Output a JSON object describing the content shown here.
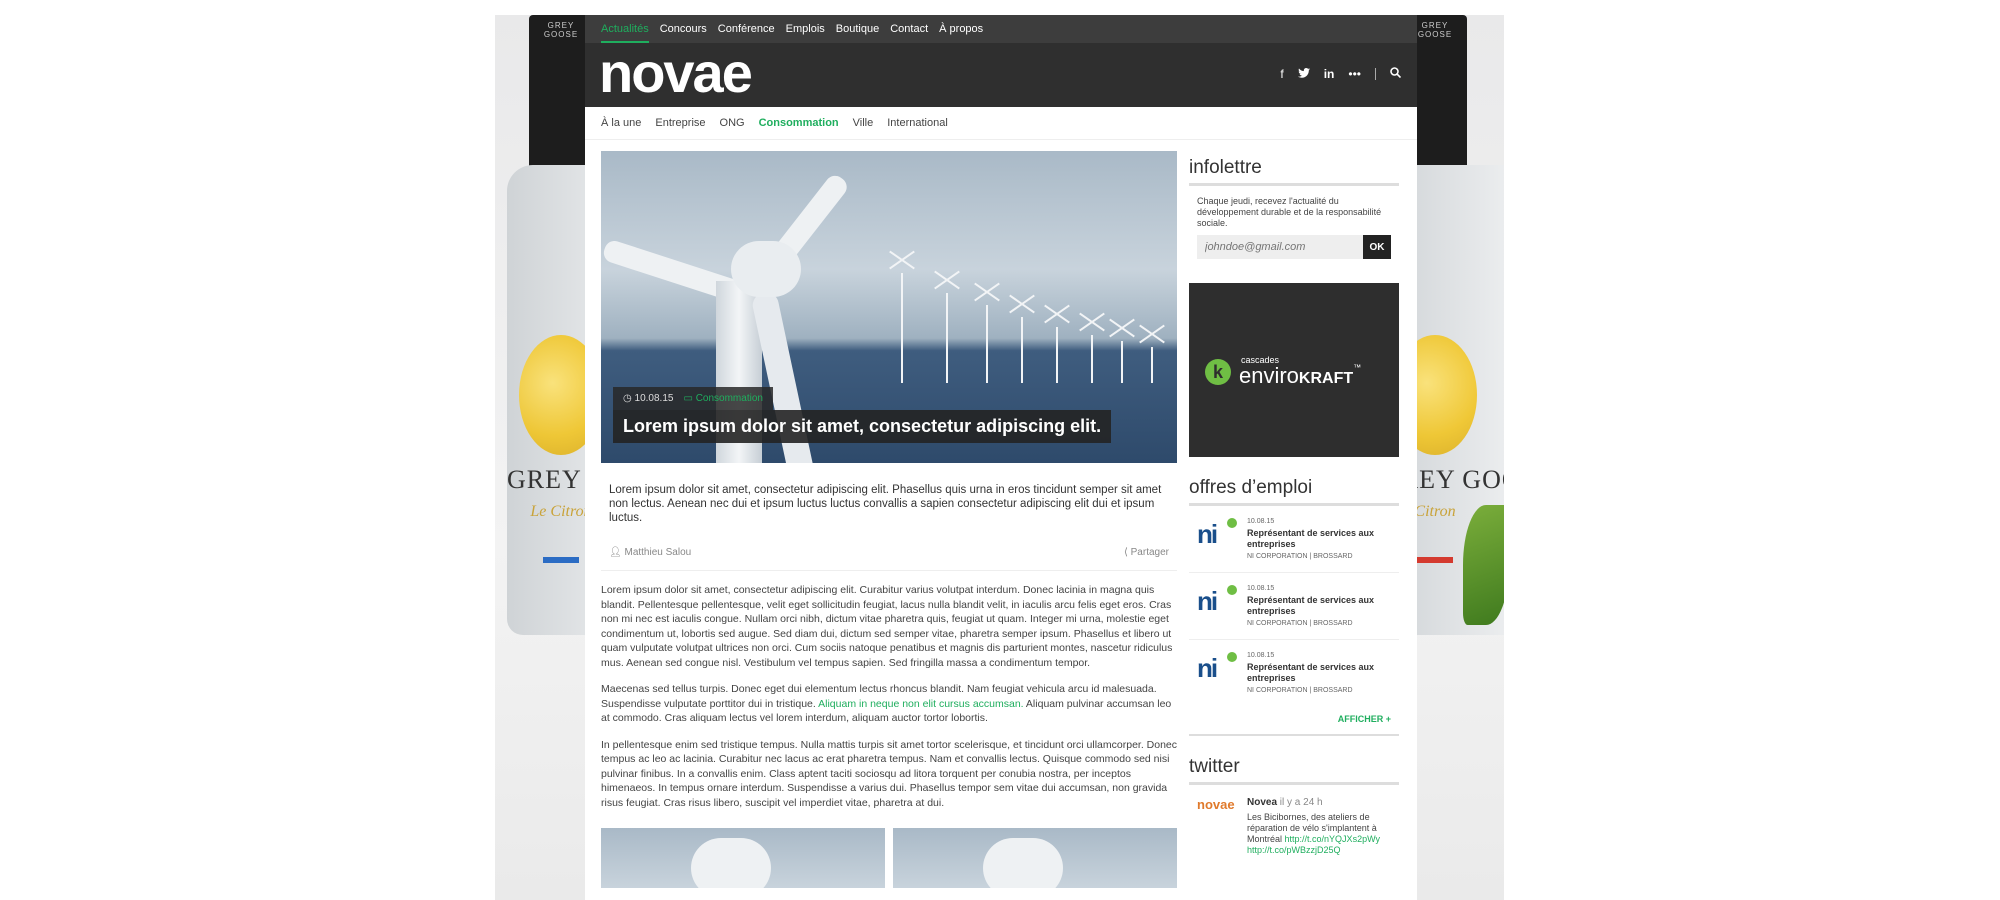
{
  "topnav": {
    "items": [
      "Actualités",
      "Concours",
      "Conférence",
      "Emplois",
      "Boutique",
      "Contact",
      "À propos"
    ]
  },
  "header": {
    "logo": "novae",
    "social_icons": [
      "facebook-icon",
      "twitter-icon",
      "linkedin-icon",
      "more-icon",
      "search-icon"
    ]
  },
  "subnav": {
    "items": [
      "À la une",
      "Entreprise",
      "ONG",
      "Consommation",
      "Ville",
      "International"
    ]
  },
  "background_ad": {
    "brand_left": "GREY GOOSE",
    "sub_left": "Le Citron",
    "brand_right": "GREY GOOSE",
    "sub_right": "Citron",
    "neck_text": "GREY GOOSE"
  },
  "article": {
    "date": "10.08.15",
    "category": "Consommation",
    "title": "Lorem ipsum dolor sit amet, consectetur adipiscing elit.",
    "lead": "Lorem ipsum dolor sit amet, consectetur adipiscing elit. Phasellus quis urna in eros tincidunt semper sit amet non lectus. Aenean nec dui et ipsum luctus luctus convallis a sapien consectetur adipiscing elit dui et ipsum luctus.",
    "author": "Matthieu Salou",
    "share_label": "Partager",
    "p1": "Lorem ipsum dolor sit amet, consectetur adipiscing elit. Curabitur varius volutpat interdum. Donec lacinia in magna quis blandit. Pellentesque pellentesque, velit eget sollicitudin feugiat, lacus nulla blandit velit, in iaculis arcu felis eget eros. Cras non mi nec est iaculis congue. Nullam orci nibh, dictum vitae pharetra quis, feugiat ut quam. Integer mi urna, molestie eget condimentum ut, lobortis sed augue. Sed diam dui, dictum sed semper vitae, pharetra semper ipsum. Phasellus et libero ut quam vulputate volutpat ultrices non orci. Cum sociis natoque penatibus et magnis dis parturient montes, nascetur ridiculus mus. Aenean sed congue nisl. Vestibulum vel tempus sapien. Sed fringilla massa a condimentum tempor.",
    "p2_before": "Maecenas sed tellus turpis. Donec eget dui elementum lectus rhoncus blandit. Nam feugiat vehicula arcu id malesuada. Suspendisse vulputate porttitor dui in tristique. ",
    "p2_link": "Aliquam in neque non elit cursus accumsan.",
    "p2_after": " Aliquam pulvinar accumsan leo at commodo. Cras aliquam lectus vel lorem interdum, aliquam auctor tortor lobortis.",
    "p3": "In pellentesque enim sed tristique tempus. Nulla mattis turpis sit amet tortor scelerisque, et tincidunt orci ullamcorper. Donec tempus ac leo ac lacinia. Curabitur nec lacus ac erat pharetra tempus. Nam et convallis lectus. Quisque commodo sed nisi pulvinar finibus. In a convallis enim. Class aptent taciti sociosqu ad litora torquent per conubia nostra, per inceptos himenaeos. In tempus ornare interdum. Suspendisse a varius dui. Phasellus tempor sem vitae dui accumsan, non gravida risus feugiat. Cras risus libero, suscipit vel imperdiet vitae, pharetra at dui."
  },
  "sidebar": {
    "newsletter": {
      "heading": "infolettre",
      "text": "Chaque jeudi, recevez l'actualité du développement durable et de la responsabilité sociale.",
      "placeholder": "johndoe@gmail.com",
      "button": "OK"
    },
    "ad": {
      "small": "cascades",
      "big": "enviro",
      "big_bold": "KRAFT",
      "tm": "™"
    },
    "jobs": {
      "heading": "offres d’emploi",
      "items": [
        {
          "date": "10.08.15",
          "title": "Représentant de services aux entreprises",
          "company": "NI CORPORATION | BROSSARD"
        },
        {
          "date": "10.08.15",
          "title": "Représentant de services aux entreprises",
          "company": "NI CORPORATION | BROSSARD"
        },
        {
          "date": "10.08.15",
          "title": "Représentant de services aux entreprises",
          "company": "NI CORPORATION | BROSSARD"
        }
      ],
      "more": "AFFICHER +"
    },
    "twitter": {
      "heading": "twitter",
      "logo": "novae",
      "name": "Novea",
      "time": "il y a 24 h",
      "text": "Les Bicibornes, des ateliers de réparation de vélo s'implantent à Montréal ",
      "link1": "http://t.co/nYQJXs2pWy",
      "link2": "http://t.co/pWBzzjD25Q"
    }
  },
  "colors": {
    "accent": "#1fae5e",
    "topbar": "#3d3d3d",
    "header": "#2f2f2f"
  }
}
